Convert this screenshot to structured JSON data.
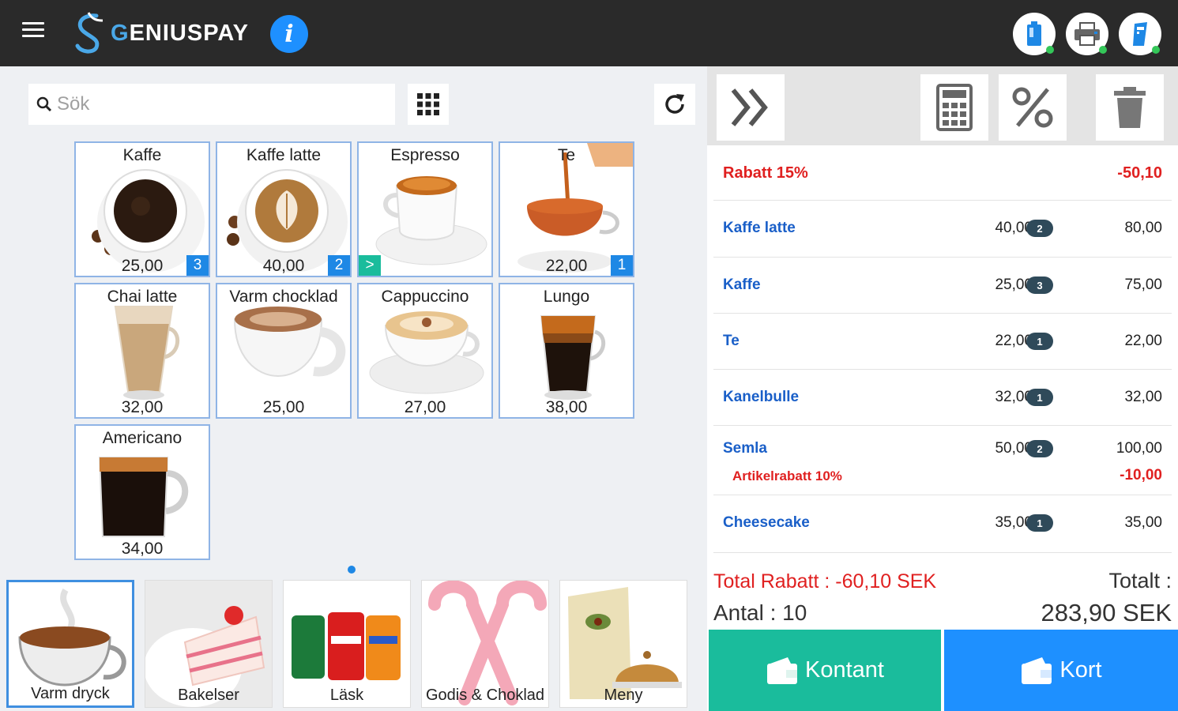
{
  "header": {
    "brand_prefix": "G",
    "brand_rest": "ENIUSPAY",
    "info_label": "i",
    "colors": {
      "bar": "#2a2a2a",
      "accent": "#1e90ff",
      "status_online": "#34c759"
    },
    "icons": [
      "battery-icon",
      "printer-icon",
      "card-reader-icon"
    ]
  },
  "search": {
    "placeholder": "Sök",
    "value": ""
  },
  "products": [
    {
      "name": "Kaffe",
      "price": "25,00",
      "count": "3"
    },
    {
      "name": "Kaffe latte",
      "price": "40,00",
      "count": "2"
    },
    {
      "name": "Espresso",
      "price": "",
      "count": ""
    },
    {
      "name": "Te",
      "price": "22,00",
      "count": "1"
    },
    {
      "name": "Chai latte",
      "price": "32,00",
      "count": ""
    },
    {
      "name": "Varm chocklad",
      "price": "25,00",
      "count": ""
    },
    {
      "name": "Cappuccino",
      "price": "27,00",
      "count": ""
    },
    {
      "name": "Lungo",
      "price": "38,00",
      "count": ""
    },
    {
      "name": "Americano",
      "price": "34,00",
      "count": ""
    }
  ],
  "espresso_arrow": ">",
  "categories": [
    {
      "label": "Varm dryck"
    },
    {
      "label": "Bakelser"
    },
    {
      "label": "Läsk"
    },
    {
      "label": "Godis & Choklad"
    },
    {
      "label": "Meny"
    }
  ],
  "cart": {
    "discount": {
      "label": "Rabatt 15%",
      "value": "-50,10"
    },
    "items": [
      {
        "name": "Kaffe latte",
        "unit": "40,00",
        "qty": "2",
        "total": "80,00"
      },
      {
        "name": "Kaffe",
        "unit": "25,00",
        "qty": "3",
        "total": "75,00"
      },
      {
        "name": "Te",
        "unit": "22,00",
        "qty": "1",
        "total": "22,00"
      },
      {
        "name": "Kanelbulle",
        "unit": "32,00",
        "qty": "1",
        "total": "32,00"
      },
      {
        "name": "Semla",
        "unit": "50,00",
        "qty": "2",
        "total": "100,00",
        "sub_label": "Artikelrabatt 10%",
        "sub_value": "-10,00"
      },
      {
        "name": "Cheesecake",
        "unit": "35,00",
        "qty": "1",
        "total": "35,00"
      }
    ]
  },
  "summary": {
    "total_discount": "Total Rabatt : -60,10 SEK",
    "count": "Antal : 10",
    "total_label": "Totalt :",
    "total_value": "283,90 SEK"
  },
  "payment": {
    "cash": "Kontant",
    "card": "Kort"
  }
}
